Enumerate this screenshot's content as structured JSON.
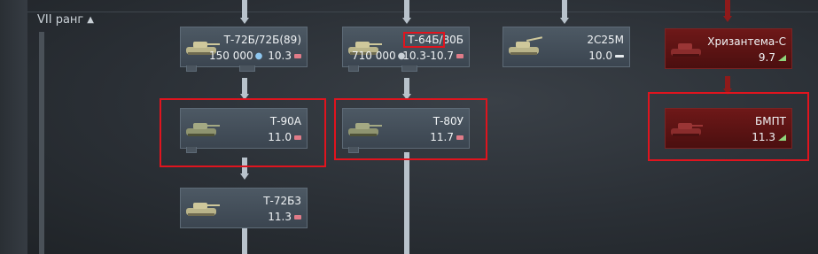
{
  "rank": {
    "label": "VII ранг"
  },
  "vehicles": {
    "t72b": {
      "name": "Т-72Б/72Б(89)",
      "price": "150 000",
      "br": "10.3"
    },
    "t64b": {
      "name": "Т-64Б/80Б",
      "price": "710 000",
      "br": "10.3-10.7"
    },
    "s2c25m": {
      "name": "2С25М",
      "br": "10.0"
    },
    "khrizantema": {
      "name": "Хризантема-С",
      "br": "9.7"
    },
    "t90a": {
      "name": "Т-90А",
      "br": "11.0"
    },
    "t80u": {
      "name": "Т-80У",
      "br": "11.7"
    },
    "bmpt": {
      "name": "БМПТ",
      "br": "11.3"
    },
    "t72b3": {
      "name": "Т-72Б3",
      "br": "11.3"
    }
  },
  "colors": {
    "highlight": "#e0141e",
    "premium_red": "#6e1818",
    "card": "#4d5964"
  },
  "icons": [
    "chevron-up-icon",
    "silver-lion-icon",
    "tank-role-icon",
    "spaa-role-icon",
    "light-tank-role-icon",
    "tank-thumbnail-icon"
  ]
}
